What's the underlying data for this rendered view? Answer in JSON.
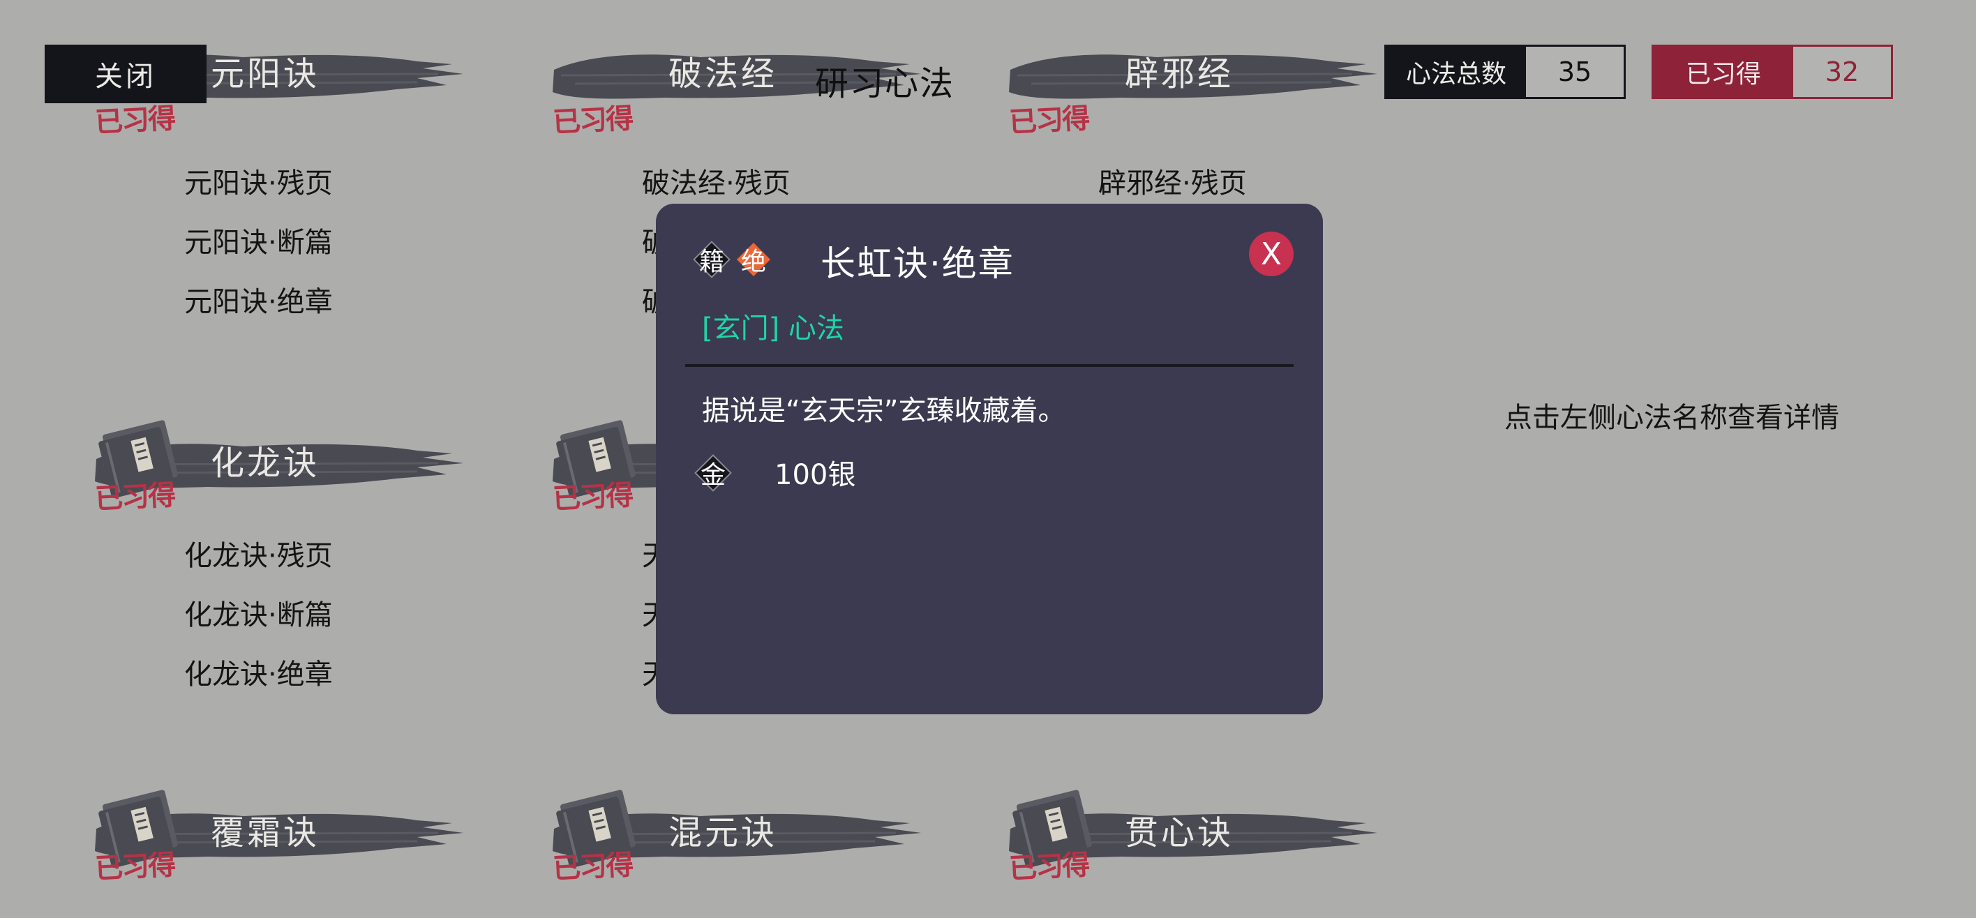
{
  "header": {
    "close_label": "关闭",
    "title": "研习心法",
    "total_label": "心法总数",
    "total_value": "35",
    "acquired_label": "已习得",
    "acquired_value": "32"
  },
  "colors": {
    "background": "#adadab",
    "dark": "#13151b",
    "accent_red": "#8e2238",
    "popup_bg": "#3b3a50",
    "category_green": "#1fd4a6",
    "rare_orange": "#e8693a"
  },
  "stamp_text": "已习得",
  "books": [
    {
      "name": "元阳诀",
      "acquired": true,
      "entries": [
        "元阳诀·残页",
        "元阳诀·断篇",
        "元阳诀·绝章"
      ]
    },
    {
      "name": "破法经",
      "acquired": true,
      "entries": [
        "破法经·残页",
        "破",
        "破"
      ]
    },
    {
      "name": "辟邪经",
      "acquired": true,
      "entries": [
        "辟邪经·残页"
      ]
    },
    {
      "name": "化龙诀",
      "acquired": true,
      "entries": [
        "化龙诀·残页",
        "化龙诀·断篇",
        "化龙诀·绝章"
      ]
    },
    {
      "name": "",
      "acquired": true,
      "entries": [
        "天",
        "天",
        "天"
      ]
    },
    {
      "name": "覆霜诀",
      "acquired": true,
      "entries": []
    },
    {
      "name": "混元诀",
      "acquired": true,
      "entries": []
    },
    {
      "name": "贯心诀",
      "acquired": true,
      "entries": []
    }
  ],
  "hint": "点击左侧心法名称查看详情",
  "popup": {
    "tag_book": "籍",
    "tag_rank": "绝",
    "title": "长虹诀·绝章",
    "close": "X",
    "category": "[玄门] 心法",
    "description": "据说是“玄天宗”玄臻收藏着。",
    "currency_icon": "金",
    "price": "100银"
  }
}
